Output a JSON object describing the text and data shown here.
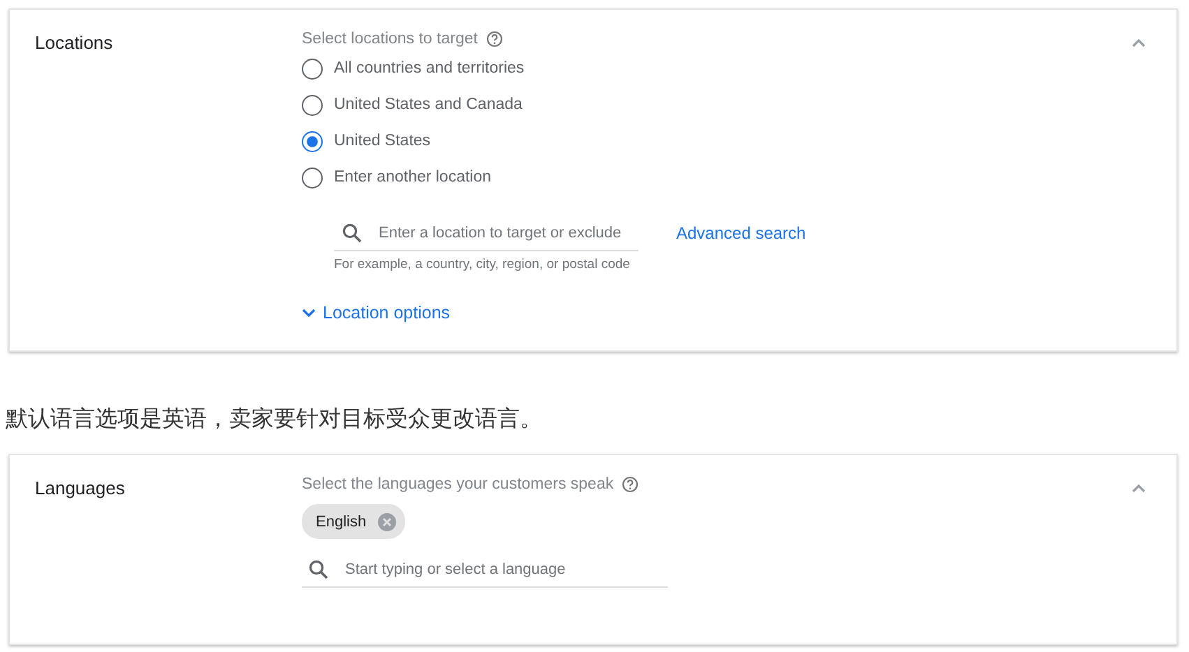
{
  "locations_card": {
    "title": "Locations",
    "expanded": true,
    "prompt": "Select locations to target",
    "options": [
      {
        "label": "All countries and territories",
        "selected": false
      },
      {
        "label": "United States and Canada",
        "selected": false
      },
      {
        "label": "United States",
        "selected": true
      },
      {
        "label": "Enter another location",
        "selected": false
      }
    ],
    "search": {
      "placeholder": "Enter a location to target or exclude",
      "helper": "For example, a country, city, region, or postal code"
    },
    "advanced_search": "Advanced search",
    "location_options": {
      "label": "Location options",
      "expanded": false
    }
  },
  "caption": "默认语言选项是英语，卖家要针对目标受众更改语言。",
  "languages_card": {
    "title": "Languages",
    "expanded": true,
    "prompt": "Select the languages your customers speak",
    "chips": [
      {
        "label": "English"
      }
    ],
    "search": {
      "placeholder": "Start typing or select a language"
    }
  }
}
